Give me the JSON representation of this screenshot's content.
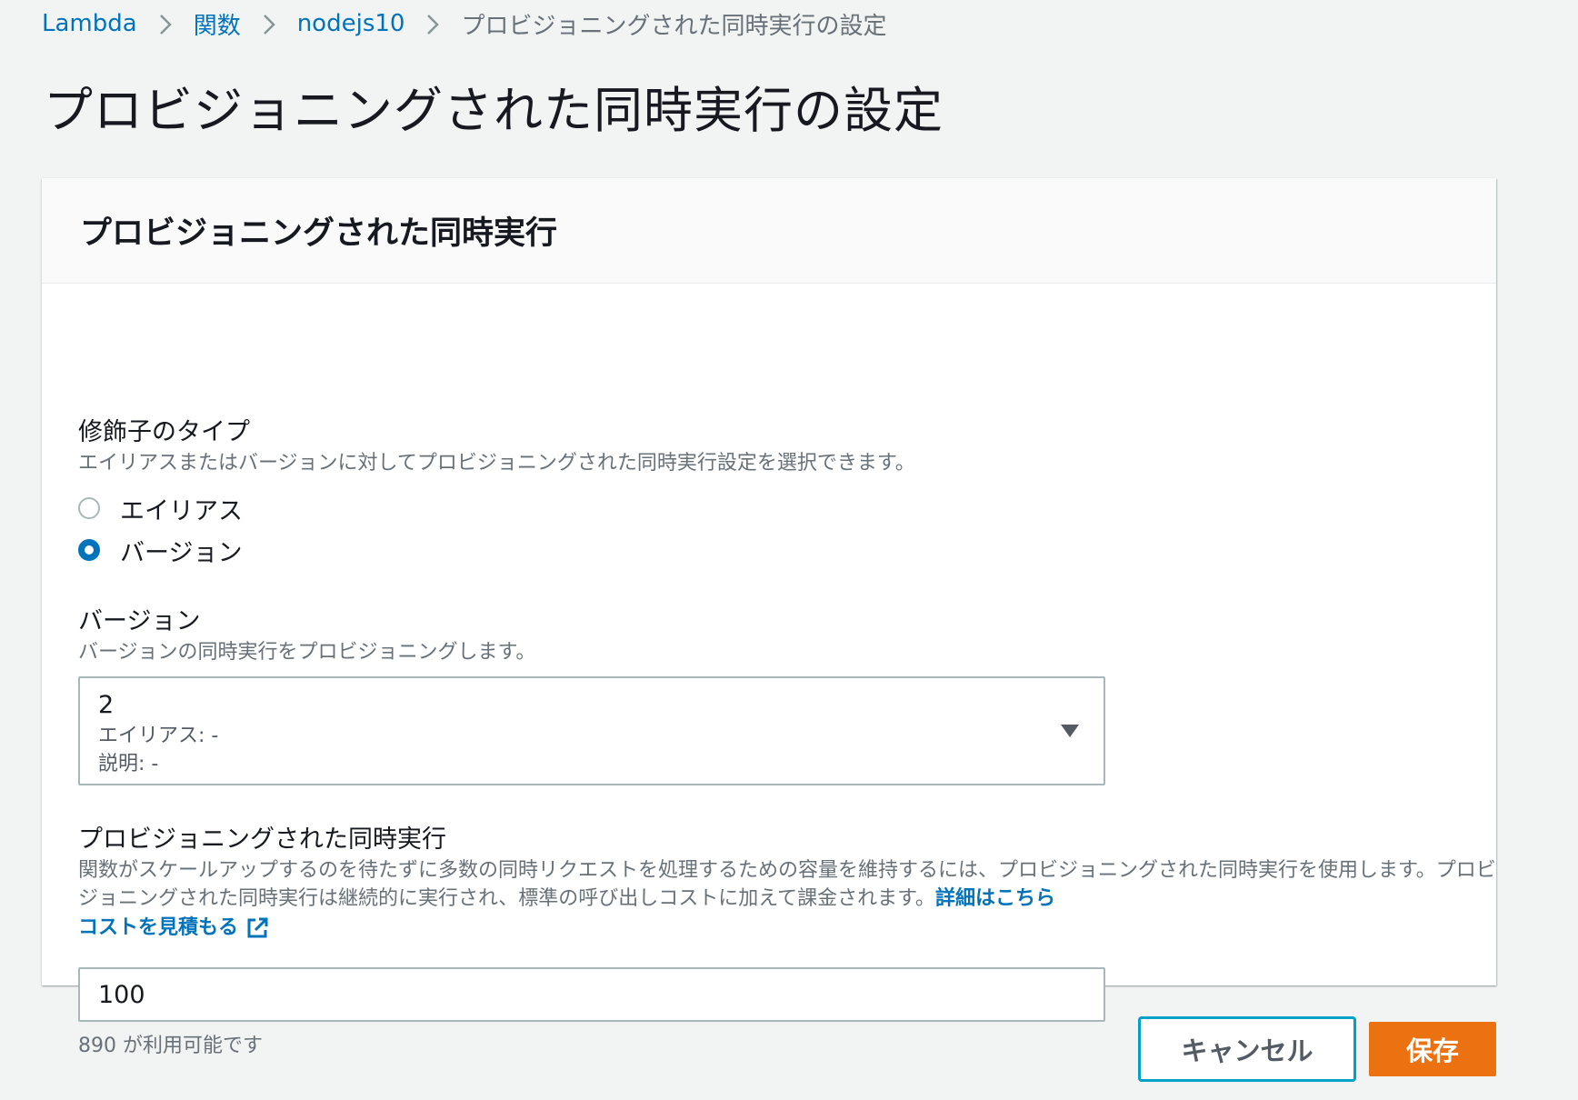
{
  "breadcrumb": {
    "items": [
      "Lambda",
      "関数",
      "nodejs10"
    ],
    "current": "プロビジョニングされた同時実行の設定"
  },
  "page": {
    "title": "プロビジョニングされた同時実行の設定"
  },
  "card": {
    "title": "プロビジョニングされた同時実行",
    "modifier": {
      "label": "修飾子のタイプ",
      "description": "エイリアスまたはバージョンに対してプロビジョニングされた同時実行設定を選択できます。",
      "options": [
        {
          "label": "エイリアス",
          "selected": false
        },
        {
          "label": "バージョン",
          "selected": true
        }
      ]
    },
    "version": {
      "label": "バージョン",
      "description": "バージョンの同時実行をプロビジョニングします。",
      "selected_value": "2",
      "alias_line": "エイリアス: -",
      "description_line": "説明: -"
    },
    "provisioned": {
      "label": "プロビジョニングされた同時実行",
      "description": "関数がスケールアップするのを待たずに多数の同時リクエストを処理するための容量を維持するには、プロビジョニングされた同時実行を使用します。プロビジョニングされた同時実行は継続的に実行され、標準の呼び出しコストに加えて課金されます。",
      "learn_more_link": "詳細はこちら",
      "cost_link": "コストを見積もる",
      "input_value": "100",
      "available_text": "890 が利用可能です"
    }
  },
  "actions": {
    "cancel_label": "キャンセル",
    "save_label": "保存"
  },
  "colors": {
    "link": "#0073bb",
    "primary_button": "#ec7211",
    "focus_border": "#00a1c9",
    "background": "#f2f3f3"
  }
}
